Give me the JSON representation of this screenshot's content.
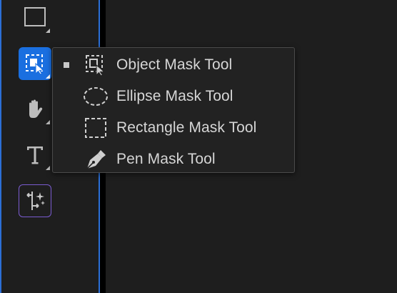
{
  "toolbar": {
    "tools": [
      {
        "name": "rectangle-shape-tool",
        "icon": "rectangle-outline-icon",
        "selected": false,
        "has_flyout": true
      },
      {
        "name": "object-mask-tool",
        "icon": "object-mask-icon",
        "selected": true,
        "has_flyout": true
      },
      {
        "name": "hand-tool",
        "icon": "hand-icon",
        "selected": false,
        "has_flyout": true
      },
      {
        "name": "type-tool",
        "icon": "type-icon",
        "selected": false,
        "has_flyout": true
      },
      {
        "name": "generative-extend-tool",
        "icon": "generative-extend-icon",
        "selected": false,
        "has_flyout": false
      }
    ]
  },
  "flyout": {
    "items": [
      {
        "label": "Object Mask Tool",
        "icon": "object-mask-icon",
        "checked": true
      },
      {
        "label": "Ellipse Mask Tool",
        "icon": "ellipse-mask-icon",
        "checked": false
      },
      {
        "label": "Rectangle Mask Tool",
        "icon": "rectangle-mask-icon",
        "checked": false
      },
      {
        "label": "Pen Mask Tool",
        "icon": "pen-mask-icon",
        "checked": false
      }
    ]
  },
  "colors": {
    "accent": "#1a6fe0",
    "panel_border": "#2b6fd6",
    "generative_border": "#7a5bd0",
    "menu_text": "#d6d6d6",
    "background": "#1e1e1e"
  }
}
